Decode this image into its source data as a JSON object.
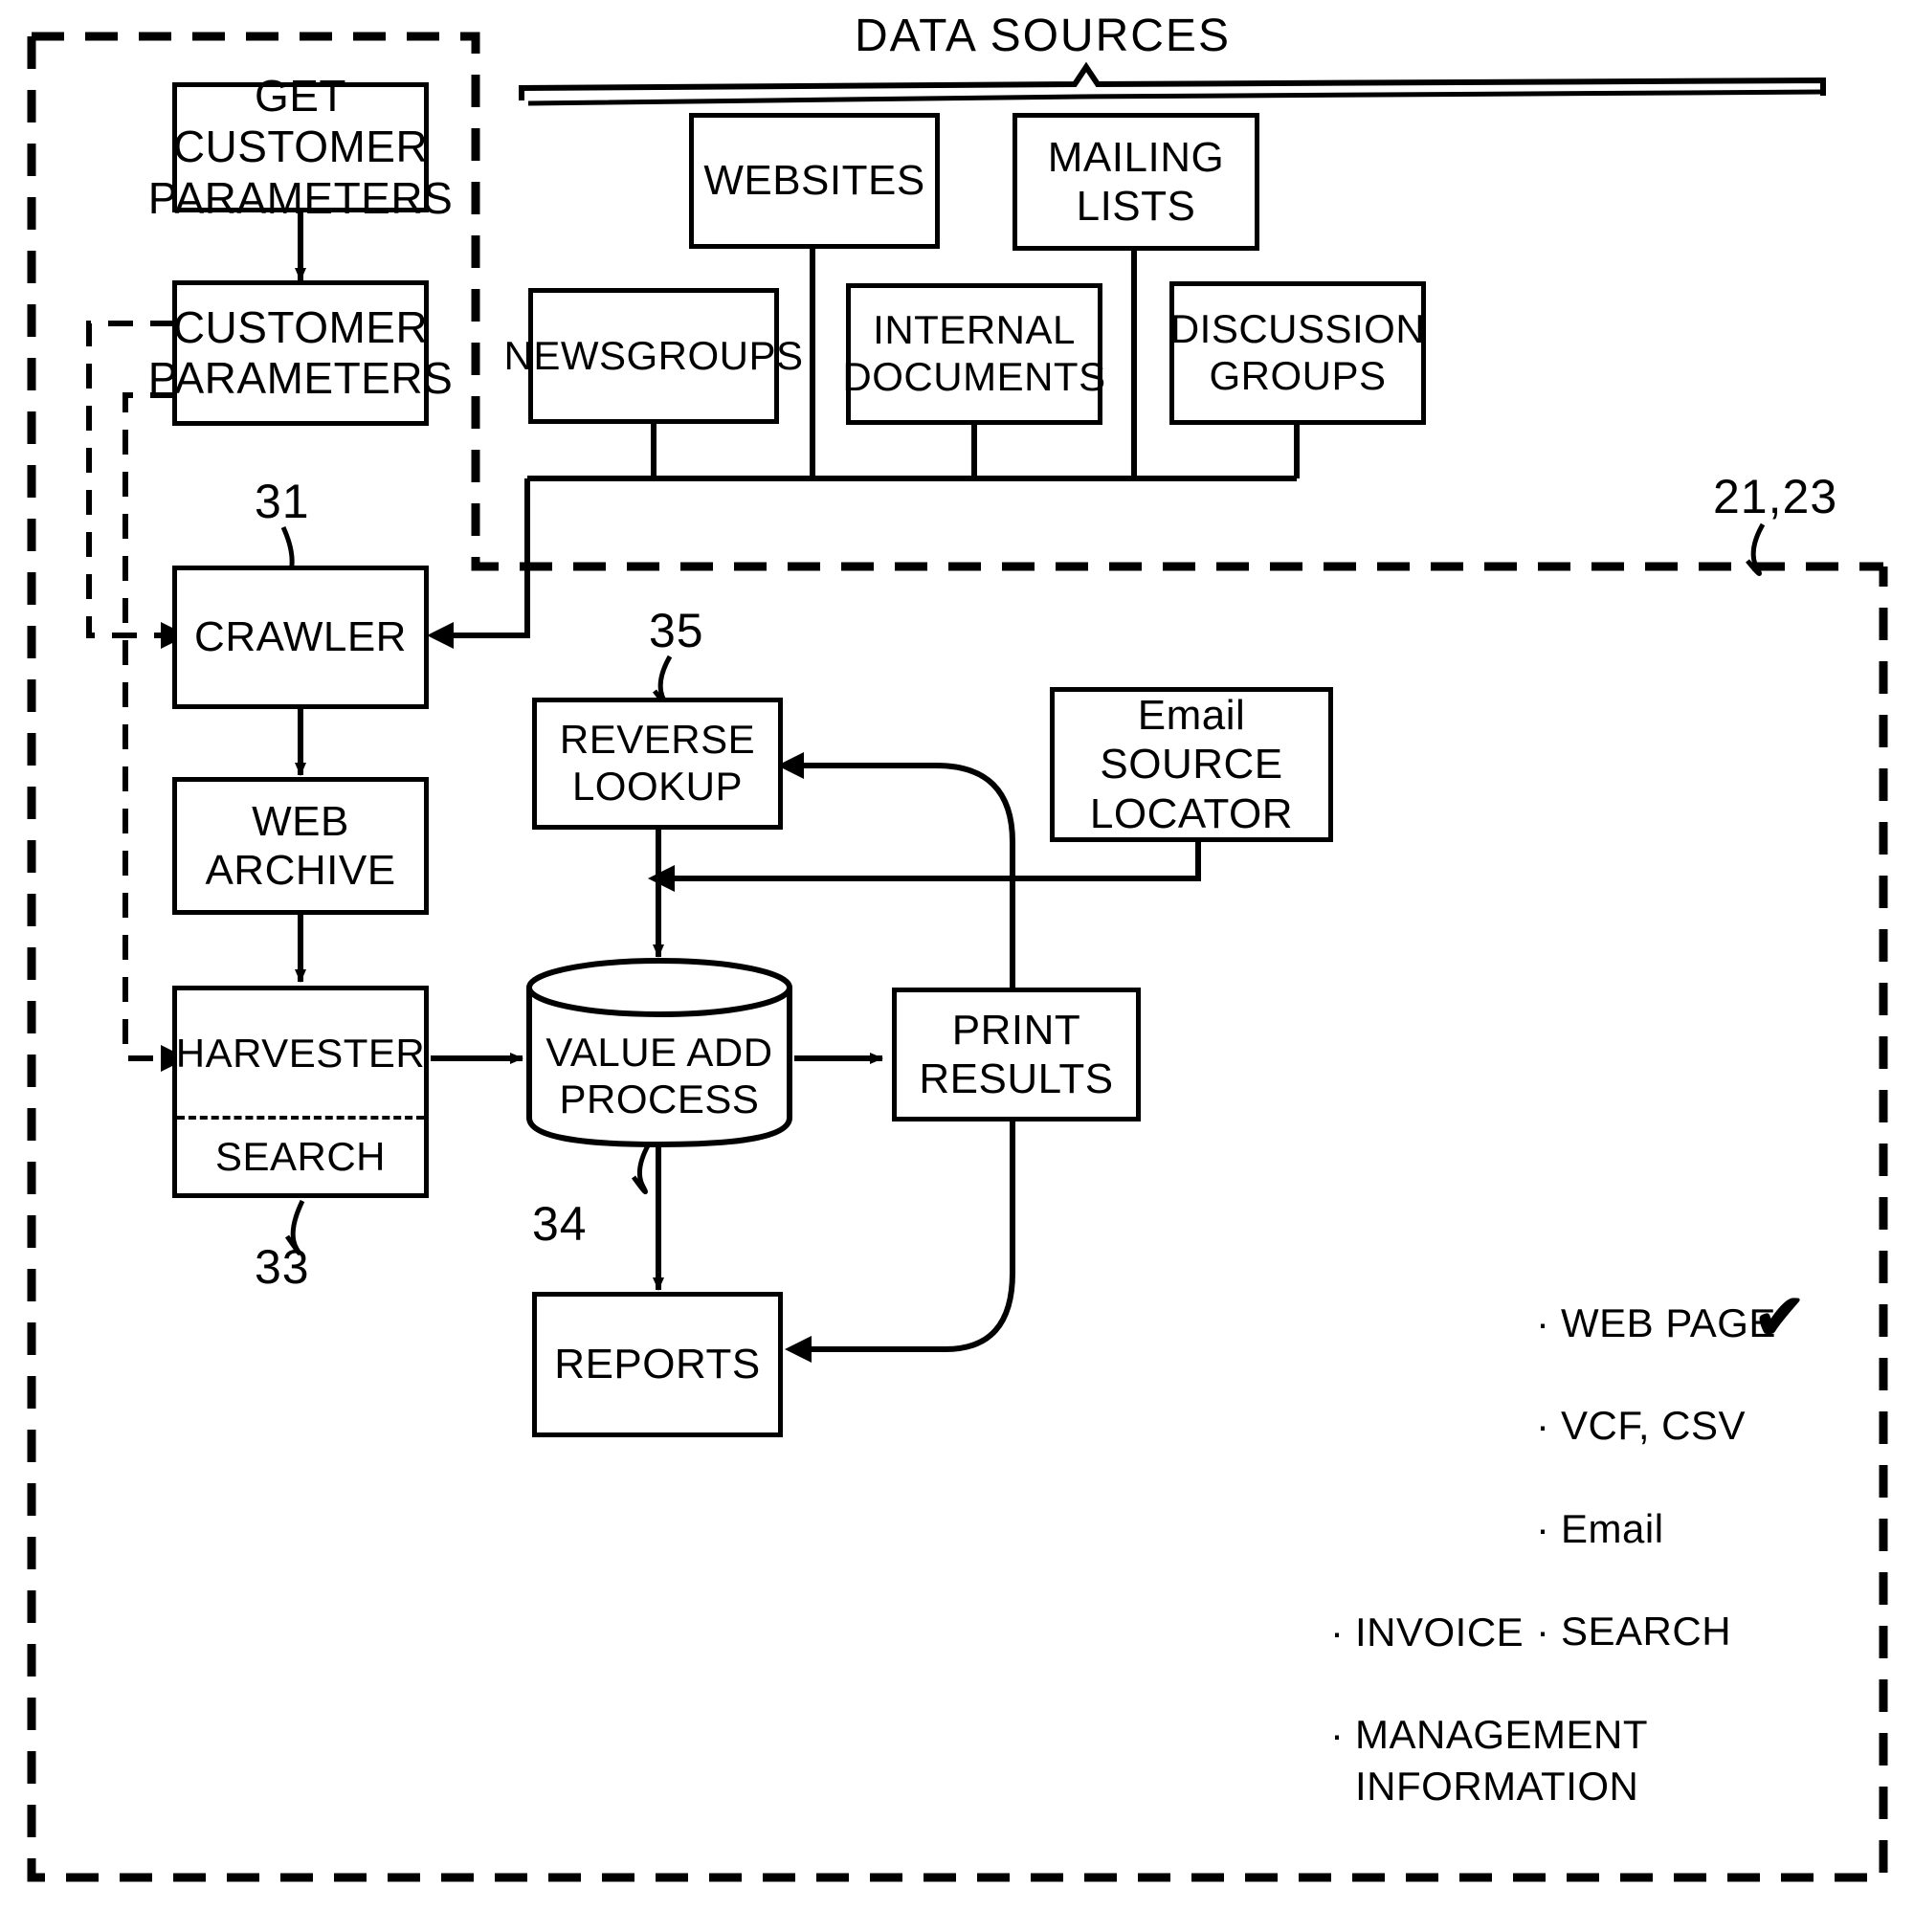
{
  "diagram": {
    "title": "DATA SOURCES",
    "nodes": {
      "get_customer_parameters": "GET CUSTOMER\nPARAMETERS",
      "customer_parameters": "CUSTOMER\nPARAMETERS",
      "crawler": "CRAWLER",
      "web_archive": "WEB ARCHIVE",
      "harvester": "HARVESTER",
      "search": "SEARCH",
      "websites": "WEBSITES",
      "mailing_lists": "MAILING LISTS",
      "newsgroups": "NEWSGROUPS",
      "internal_documents": "INTERNAL\nDOCUMENTS",
      "discussion_groups": "DISCUSSION\nGROUPS",
      "reverse_lookup": "REVERSE\nLOOKUP",
      "email_source_locator": "Email SOURCE\nLOCATOR",
      "value_add_process": "VALUE ADD\nPROCESS",
      "print_results": "PRINT\nRESULTS",
      "reports": "REPORTS"
    },
    "reference_numbers": {
      "crawler_ref": "31",
      "harvester_ref": "33",
      "value_add_ref": "34",
      "reverse_lookup_ref": "35",
      "system_ref": "21,23"
    },
    "print_outputs": [
      "WEB PAGE",
      "VCF, CSV",
      "Email",
      "SEARCH"
    ],
    "report_outputs": [
      "INVOICE",
      "MANAGEMENT\nINFORMATION"
    ],
    "annotations": {
      "checkmark": "✔"
    },
    "colors": {
      "ink": "#000000",
      "paper": "#ffffff"
    }
  }
}
